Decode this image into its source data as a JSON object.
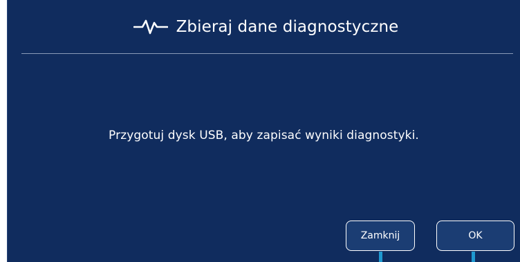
{
  "dialog": {
    "title": "Zbieraj dane diagnostyczne",
    "title_icon": "pulse-icon",
    "message": "Przygotuj dysk USB, aby zapisać wyniki diagnostyki.",
    "buttons": {
      "close_label": "Zamknij",
      "ok_label": "OK"
    }
  },
  "colors": {
    "background": "#102c5e",
    "button_fill": "#1b3d73",
    "accent": "#1f9ad0",
    "text": "#ffffff"
  }
}
